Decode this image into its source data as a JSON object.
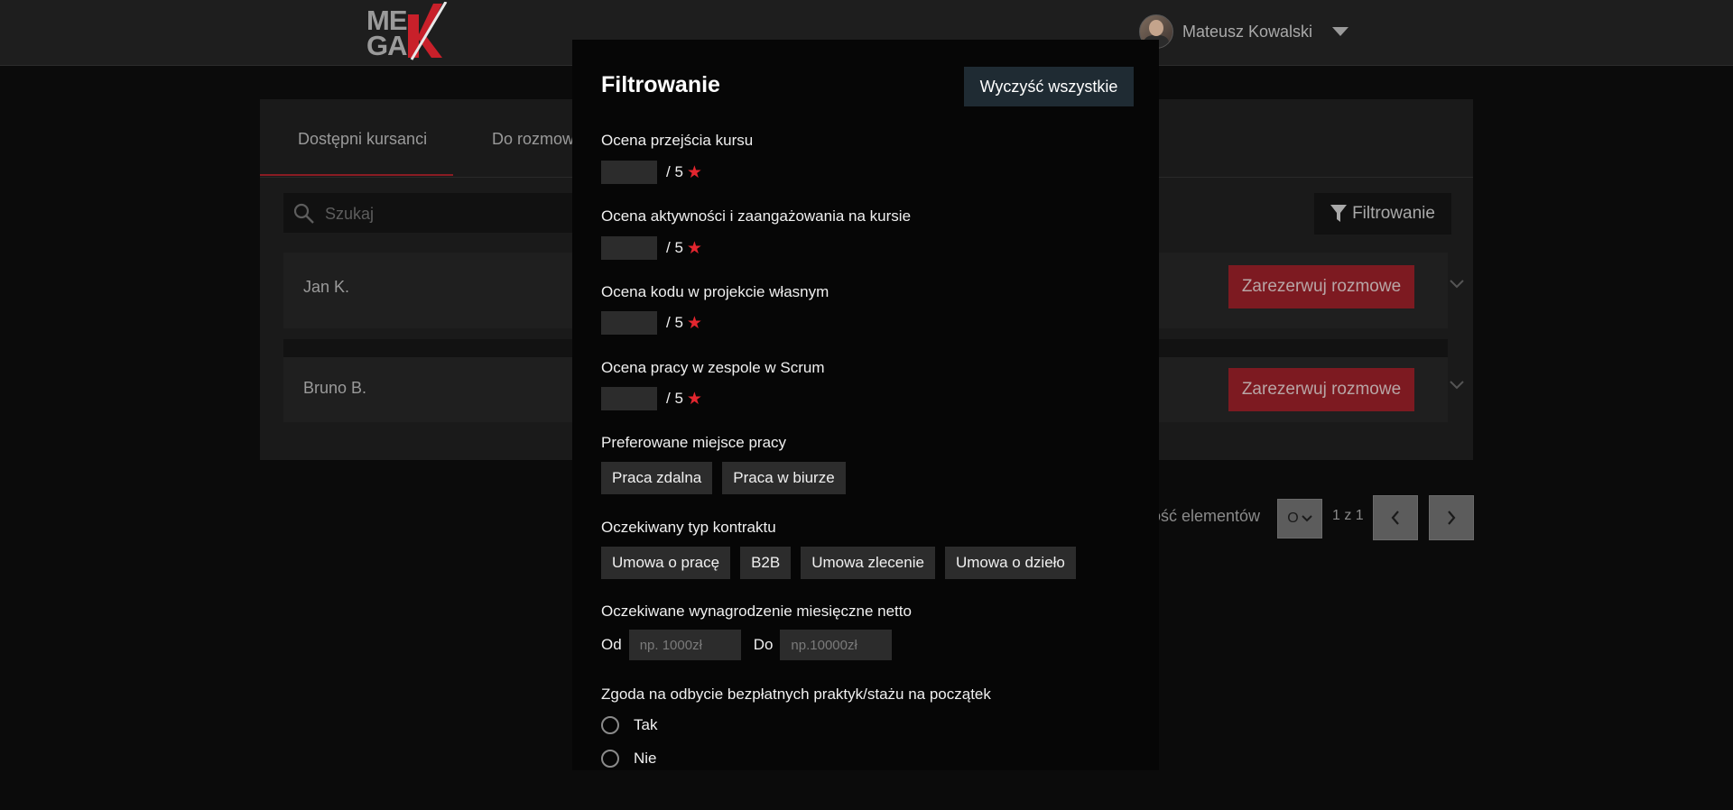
{
  "header": {
    "logo_top": "ME",
    "logo_bottom": "GA",
    "user_name": "Mateusz Kowalski"
  },
  "tabs": [
    {
      "label": "Dostępni kursanci"
    },
    {
      "label": "Do rozmow"
    }
  ],
  "search": {
    "placeholder": "Szukaj"
  },
  "filter_button": "Filtrowanie",
  "students": [
    {
      "name": "Jan K.",
      "action": "Zarezerwuj rozmowe"
    },
    {
      "name": "Bruno B.",
      "action": "Zarezerwuj rozmowe"
    }
  ],
  "pagination": {
    "per_page_label": "ość elementów",
    "per_page_value": "O",
    "page_info": "1 z 1"
  },
  "modal": {
    "title": "Filtrowanie",
    "clear_all": "Wyczyść wszystkie",
    "ratings": [
      {
        "label": "Ocena przejścia kursu",
        "suffix": "/ 5"
      },
      {
        "label": "Ocena aktywności i zaangażowania na kursie",
        "suffix": "/ 5"
      },
      {
        "label": "Ocena kodu w projekcie własnym",
        "suffix": "/ 5"
      },
      {
        "label": "Ocena pracy w zespole w Scrum",
        "suffix": "/ 5"
      }
    ],
    "workplace": {
      "label": "Preferowane miejsce pracy",
      "options": [
        "Praca zdalna",
        "Praca w biurze"
      ]
    },
    "contract": {
      "label": "Oczekiwany typ kontraktu",
      "options": [
        "Umowa o pracę",
        "B2B",
        "Umowa zlecenie",
        "Umowa o dzieło"
      ]
    },
    "salary": {
      "label": "Oczekiwane wynagrodzenie miesięczne netto",
      "from_label": "Od",
      "from_placeholder": "np. 1000zł",
      "to_label": "Do",
      "to_placeholder": "np.10000zł"
    },
    "internship": {
      "label": "Zgoda na odbycie bezpłatnych praktyk/stażu na początek",
      "options": [
        "Tak",
        "Nie"
      ]
    }
  },
  "colors": {
    "accent_red": "#e3262f",
    "reserve_button": "#7d1a21",
    "clear_button": "#1f2b33"
  }
}
